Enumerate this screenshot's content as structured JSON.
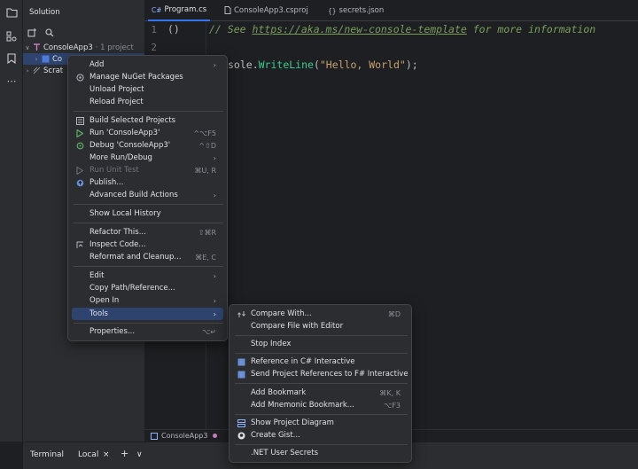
{
  "project_panel": {
    "title": "Solution",
    "tree": [
      {
        "label": "ConsoleApp3",
        "suffix": "· 1 project"
      },
      {
        "label": "Co"
      },
      {
        "label": "Scrat"
      }
    ]
  },
  "tabs": [
    {
      "icon": "C#",
      "label": "Program.cs"
    },
    {
      "label": "ConsoleApp3.csproj"
    },
    {
      "label": "secrets.json"
    }
  ],
  "editor": {
    "line_numbers": [
      "1",
      "2"
    ],
    "line1_brackets": "()",
    "line1_comment_prefix": "// See ",
    "line1_link": "https://aka.ms/new-console-template",
    "line1_comment_suffix": " for more information",
    "line3_obj": "sole.",
    "line3_method": "WriteLine",
    "line3_open": "(",
    "line3_string": "\"Hello, World\"",
    "line3_close": ");"
  },
  "breadcrumb": {
    "label": "ConsoleApp3"
  },
  "bottom_bar": {
    "terminal": "Terminal",
    "local_tab": "Local",
    "local_close": "×",
    "add": "+",
    "dropdown": "∨"
  },
  "context_menu": {
    "items": [
      {
        "label": "Add",
        "sub": "›"
      },
      {
        "label": "Manage NuGet Packages"
      },
      {
        "label": "Unload Project"
      },
      {
        "label": "Reload Project"
      },
      {
        "label": "Build Selected Projects"
      },
      {
        "label": "Run 'ConsoleApp3'",
        "shortcut": "^⌥F5"
      },
      {
        "label": "Debug 'ConsoleApp3'",
        "shortcut": "^⇧D"
      },
      {
        "label": "More Run/Debug",
        "sub": "›"
      },
      {
        "label": "Run Unit Test",
        "shortcut": "⌘U, R"
      },
      {
        "label": "Publish..."
      },
      {
        "label": "Advanced Build Actions",
        "sub": "›"
      },
      {
        "label": "Show Local History"
      },
      {
        "label": "Refactor This...",
        "shortcut": "⇧⌘R"
      },
      {
        "label": "Inspect Code..."
      },
      {
        "label": "Reformat and Cleanup...",
        "shortcut": "⌘E, C"
      },
      {
        "label": "Edit",
        "sub": "›"
      },
      {
        "label": "Copy Path/Reference..."
      },
      {
        "label": "Open In",
        "sub": "›"
      },
      {
        "label": "Tools",
        "sub": "›"
      },
      {
        "label": "Properties...",
        "shortcut": "⌥↵"
      }
    ]
  },
  "tools_submenu": {
    "items": [
      {
        "label": "Compare With...",
        "shortcut": "⌘D"
      },
      {
        "label": "Compare File with Editor"
      },
      {
        "label": "Stop Index"
      },
      {
        "label": "Reference in C# Interactive"
      },
      {
        "label": "Send Project References to F# Interactive"
      },
      {
        "label": "Add Bookmark",
        "shortcut": "⌘K, K"
      },
      {
        "label": "Add Mnemonic Bookmark...",
        "shortcut": "⌥F3"
      },
      {
        "label": "Show Project Diagram"
      },
      {
        "label": "Create Gist..."
      },
      {
        "label": ".NET User Secrets"
      }
    ]
  },
  "colors": {
    "accent": "#3574f0",
    "selection": "#2e436e",
    "run_green": "#5fb865",
    "panel_bg": "#2b2d30",
    "editor_bg": "#1e1f22"
  }
}
